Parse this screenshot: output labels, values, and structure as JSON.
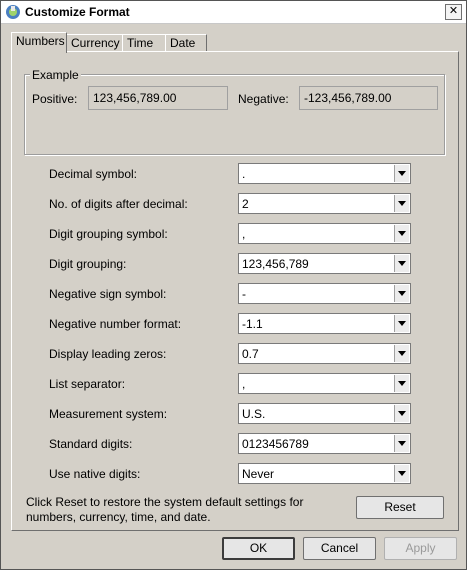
{
  "window": {
    "title": "Customize Format",
    "close_glyph": "✕"
  },
  "tabs": [
    {
      "label": "Numbers"
    },
    {
      "label": "Currency"
    },
    {
      "label": "Time"
    },
    {
      "label": "Date"
    }
  ],
  "example": {
    "group_label": "Example",
    "positive_label": "Positive:",
    "positive_value": "123,456,789.00",
    "negative_label": "Negative:",
    "negative_value": "-123,456,789.00"
  },
  "settings": [
    {
      "label": "Decimal symbol:",
      "value": "."
    },
    {
      "label": "No. of digits after decimal:",
      "value": "2"
    },
    {
      "label": "Digit grouping symbol:",
      "value": ","
    },
    {
      "label": "Digit grouping:",
      "value": "123,456,789"
    },
    {
      "label": "Negative sign symbol:",
      "value": "-"
    },
    {
      "label": "Negative number format:",
      "value": "-1.1"
    },
    {
      "label": "Display leading zeros:",
      "value": "0.7"
    },
    {
      "label": "List separator:",
      "value": ","
    },
    {
      "label": "Measurement system:",
      "value": "U.S."
    },
    {
      "label": "Standard digits:",
      "value": "0123456789"
    },
    {
      "label": "Use native digits:",
      "value": "Never"
    }
  ],
  "hint": "Click Reset to restore the system default settings for numbers, currency, time, and date.",
  "buttons": {
    "reset": "Reset",
    "ok": "OK",
    "cancel": "Cancel",
    "apply": "Apply"
  }
}
